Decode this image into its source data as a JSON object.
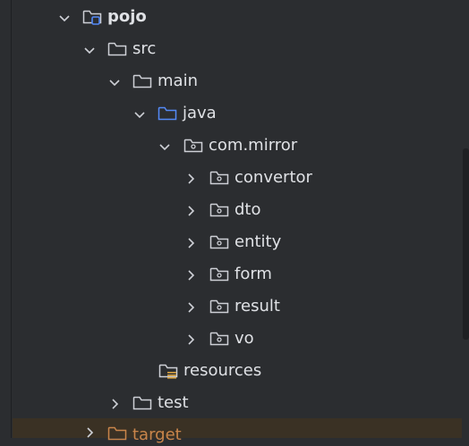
{
  "project_tree": {
    "rows": [
      {
        "label": "pojo",
        "expanded": true,
        "icon": "module-folder-icon"
      },
      {
        "label": "src",
        "expanded": true,
        "icon": "folder-icon"
      },
      {
        "label": "main",
        "expanded": true,
        "icon": "folder-icon"
      },
      {
        "label": "java",
        "expanded": true,
        "icon": "source-root-folder-icon"
      },
      {
        "label": "com.mirror",
        "expanded": true,
        "icon": "package-icon"
      },
      {
        "label": "convertor",
        "expanded": false,
        "icon": "package-icon"
      },
      {
        "label": "dto",
        "expanded": false,
        "icon": "package-icon"
      },
      {
        "label": "entity",
        "expanded": false,
        "icon": "package-icon"
      },
      {
        "label": "form",
        "expanded": false,
        "icon": "package-icon"
      },
      {
        "label": "result",
        "expanded": false,
        "icon": "package-icon"
      },
      {
        "label": "vo",
        "expanded": false,
        "icon": "package-icon"
      },
      {
        "label": "resources",
        "expanded": null,
        "icon": "resources-folder-icon"
      },
      {
        "label": "test",
        "expanded": false,
        "icon": "folder-icon"
      },
      {
        "label": "target",
        "expanded": false,
        "icon": "excluded-folder-icon"
      }
    ]
  },
  "colors": {
    "background": "#2b2d30",
    "text": "#dfe1e5",
    "icon_gray": "#ced0d6",
    "source_root_blue": "#548af7",
    "module_blue": "#548af7",
    "resources_yellow": "#d9a343",
    "excluded_orange": "#c9854a",
    "excluded_row_bg": "#3a3124"
  }
}
